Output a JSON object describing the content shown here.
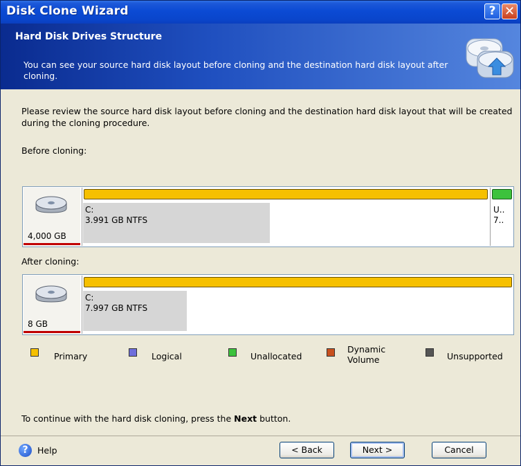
{
  "window": {
    "title": "Disk Clone Wizard",
    "help_glyph": "?",
    "close_glyph": "✕"
  },
  "header": {
    "title": "Hard Disk Drives Structure",
    "description": "You can see your source hard disk layout before cloning and the destination hard disk layout after cloning.",
    "icon": "disk-clone-icon"
  },
  "body": {
    "instruction": "Please review the source hard disk layout before cloning and the destination hard disk layout that will be created during the cloning procedure."
  },
  "before": {
    "label": "Before cloning:",
    "disk_size": "4,000 GB",
    "partition": {
      "name": "C:",
      "size": "3.991 GB  NTFS",
      "used_fraction": 0.46
    },
    "unallocated": {
      "line1": "U..",
      "line2": "7.."
    }
  },
  "after": {
    "label": "After cloning:",
    "disk_size": "8 GB",
    "partition": {
      "name": "C:",
      "size": "7.997 GB  NTFS",
      "used_fraction": 0.24
    }
  },
  "legend": [
    {
      "label": "Primary",
      "color": "#f6c000"
    },
    {
      "label": "Logical",
      "color": "#6e6edb"
    },
    {
      "label": "Unallocated",
      "color": "#3cc23c"
    },
    {
      "label": "Dynamic Volume",
      "color": "#c8501e"
    },
    {
      "label": "Unsupported",
      "color": "#555555"
    }
  ],
  "footer": {
    "text_before": "To continue with the hard disk cloning, press the ",
    "text_bold": "Next",
    "text_after": " button."
  },
  "buttons": {
    "help": "Help",
    "back": "< Back",
    "next": "Next >",
    "cancel": "Cancel"
  }
}
